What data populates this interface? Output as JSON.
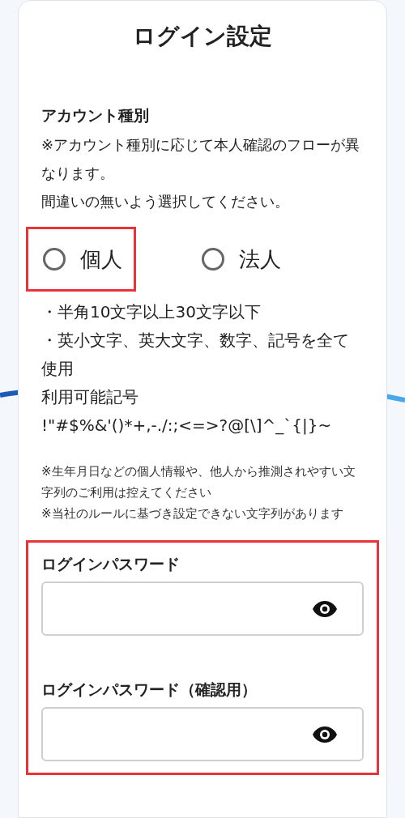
{
  "title": "ログイン設定",
  "account_type": {
    "label": "アカウント種別",
    "notes": [
      "※アカウント種別に応じて本人確認のフローが異なります。",
      "間違いの無いよう選択してください。"
    ],
    "options": [
      {
        "label": "個人",
        "selected": false,
        "highlighted": true
      },
      {
        "label": "法人",
        "selected": false,
        "highlighted": false
      }
    ]
  },
  "password_rules": [
    "・半角10文字以上30文字以下",
    "・英小文字、英大文字、数字、記号を全て使用",
    "利用可能記号",
    "!\"#$%&'()*+,-./:;<=>?@[\\]^_`{|}~"
  ],
  "cautions": [
    "※生年月日などの個人情報や、他人から推測されやすい文字列のご利用は控えてください",
    "※当社のルールに基づき設定できない文字列があります"
  ],
  "password_section": {
    "highlighted": true,
    "fields": [
      {
        "label": "ログインパスワード"
      },
      {
        "label": "ログインパスワード（確認用）"
      }
    ]
  }
}
